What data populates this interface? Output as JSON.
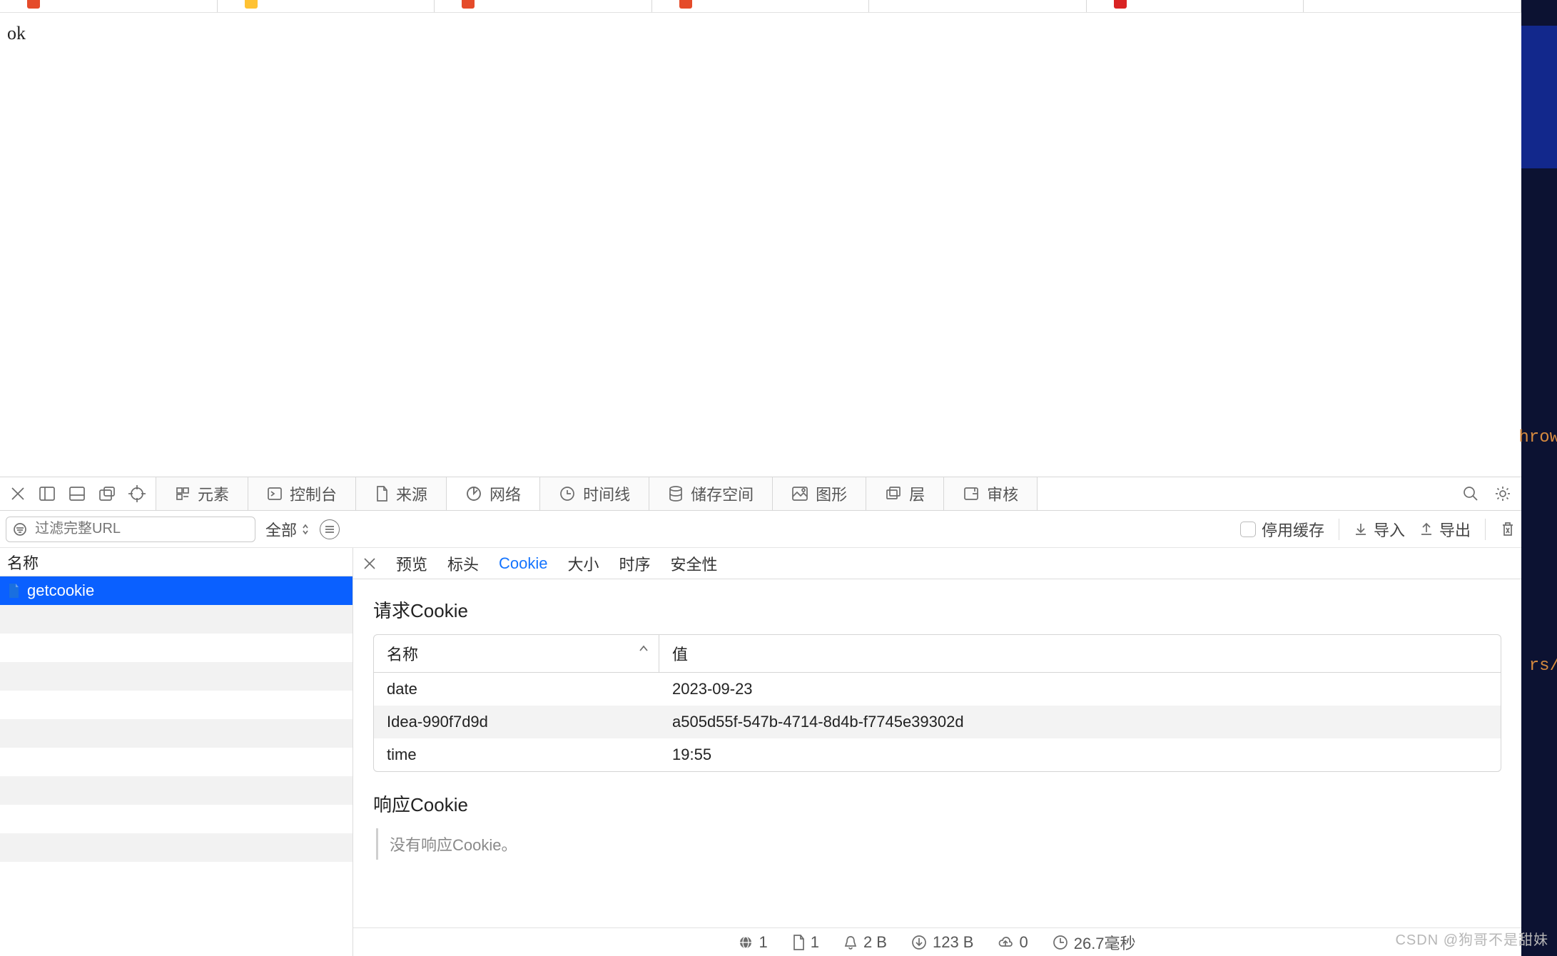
{
  "page": {
    "body_text": "ok"
  },
  "devtools": {
    "icon_tabs": [
      "elements",
      "console",
      "sources",
      "network",
      "timeline",
      "storage",
      "graphics",
      "layers",
      "audit"
    ],
    "panel_labels": {
      "elements": "元素",
      "console": "控制台",
      "sources": "来源",
      "network": "网络",
      "timeline": "时间线",
      "storage": "储存空间",
      "graphics": "图形",
      "layers": "层",
      "audit": "审核"
    },
    "active_panel": "network"
  },
  "filter": {
    "placeholder": "过滤完整URL",
    "type_label": "全部",
    "disable_cache_label": "停用缓存",
    "import_label": "导入",
    "export_label": "导出"
  },
  "requests": {
    "column_header": "名称",
    "items": [
      "getcookie"
    ],
    "selected_index": 0
  },
  "detail": {
    "tabs": [
      "预览",
      "标头",
      "Cookie",
      "大小",
      "时序",
      "安全性"
    ],
    "active_tab": "Cookie",
    "request_cookies": {
      "title": "请求Cookie",
      "columns": [
        "名称",
        "值"
      ],
      "rows": [
        {
          "name": "date",
          "value": "2023-09-23"
        },
        {
          "name": "Idea-990f7d9d",
          "value": "a505d55f-547b-4714-8d4b-f7745e39302d"
        },
        {
          "name": "time",
          "value": "19:55"
        }
      ]
    },
    "response_cookies": {
      "title": "响应Cookie",
      "empty_message": "没有响应Cookie。"
    }
  },
  "status": {
    "requests": "1",
    "documents": "1",
    "warnings": "2 B",
    "transferred": "123 B",
    "uploaded": "0",
    "time": "26.7毫秒"
  },
  "side": {
    "snippet1": "hrow",
    "snippet2": "rs/"
  },
  "watermark": "CSDN @狗哥不是甜妹"
}
